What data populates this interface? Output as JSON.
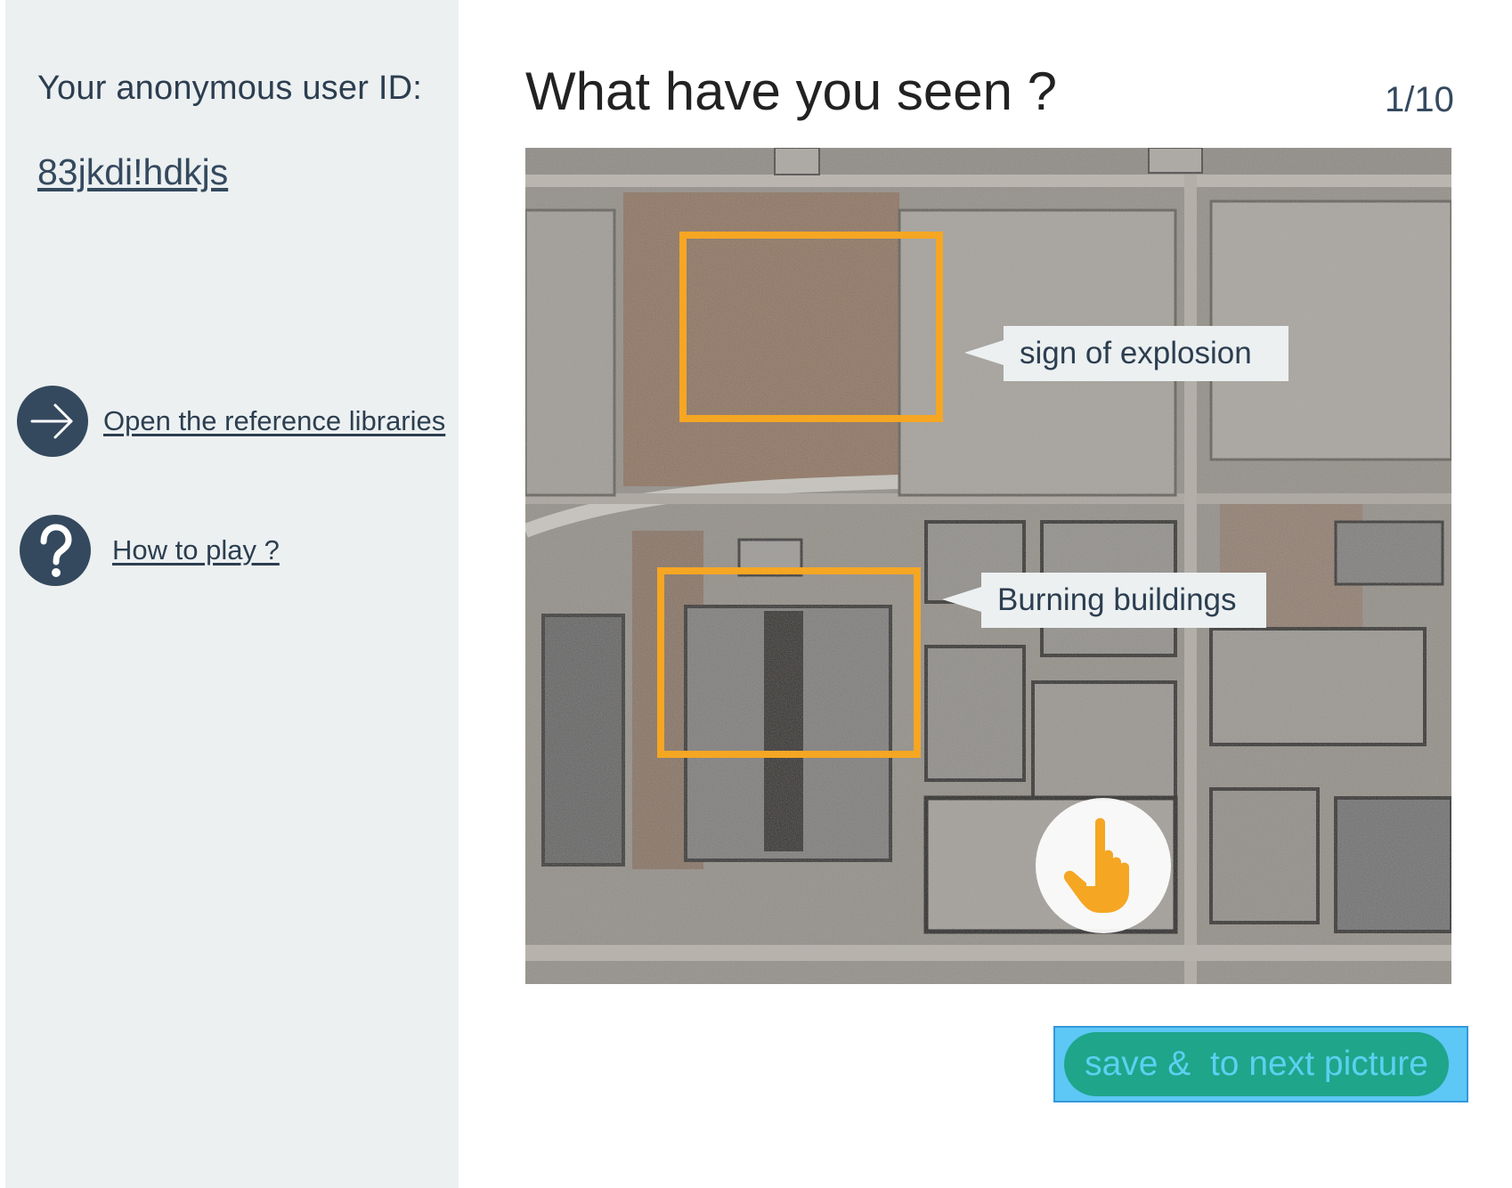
{
  "sidebar": {
    "user_id_label": "Your anonymous user ID:",
    "user_id": "83jkdi!hdkjs",
    "links": [
      {
        "label": "Open the reference libraries",
        "icon": "arrow-right-icon"
      },
      {
        "label": "How to play ?",
        "icon": "question-mark-icon"
      }
    ]
  },
  "main": {
    "title": "What have you seen ?",
    "counter": "1/10",
    "annotations": [
      {
        "label": "sign of explosion"
      },
      {
        "label": "Burning buildings"
      }
    ],
    "cursor_icon": "pointing-hand-icon",
    "save_button": "save &  to next picture"
  },
  "colors": {
    "sidebar_bg": "#ecf0f1",
    "icon_circle": "#34495e",
    "annotation_box": "#f5a623",
    "save_button": "#1ea58a",
    "save_button_text": "#5cd0f0",
    "selection_highlight": "#5dc7f5"
  }
}
